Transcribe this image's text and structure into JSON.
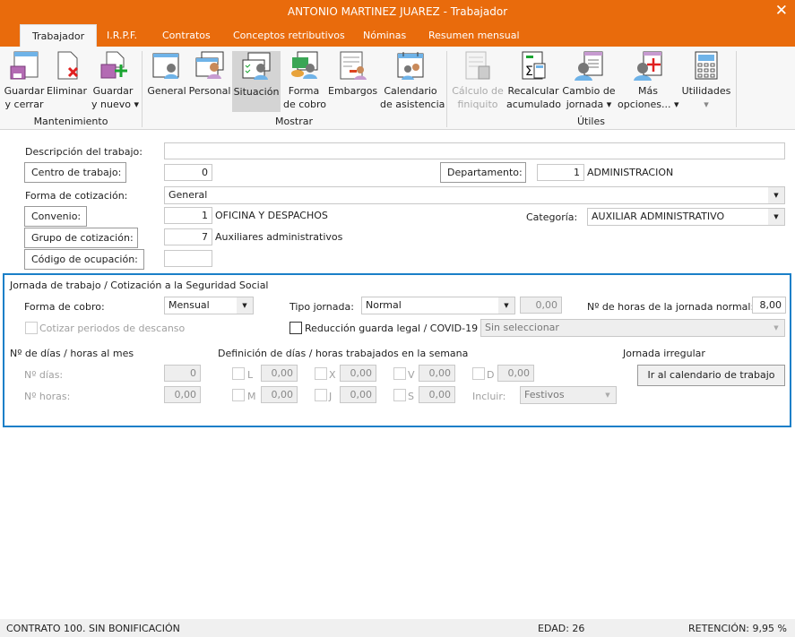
{
  "window": {
    "title": "ANTONIO MARTINEZ JUAREZ - Trabajador",
    "close_icon": "close-icon"
  },
  "tabs": [
    {
      "label": "Trabajador",
      "active": true
    },
    {
      "label": "I.R.P.F."
    },
    {
      "label": "Contratos"
    },
    {
      "label": "Conceptos retributivos"
    },
    {
      "label": "Nóminas"
    },
    {
      "label": "Resumen mensual"
    }
  ],
  "ribbon": {
    "groups": {
      "mantenimiento": "Mantenimiento",
      "mostrar": "Mostrar",
      "utiles": "Útiles"
    },
    "buttons": {
      "guardar_cerrar": [
        "Guardar",
        "y cerrar"
      ],
      "eliminar": [
        "Eliminar",
        ""
      ],
      "guardar_nuevo": [
        "Guardar",
        "y nuevo ▾"
      ],
      "general": [
        "General",
        ""
      ],
      "personal": [
        "Personal",
        ""
      ],
      "situacion": [
        "Situación",
        ""
      ],
      "forma_cobro": [
        "Forma",
        "de cobro"
      ],
      "embargos": [
        "Embargos",
        ""
      ],
      "calendario": [
        "Calendario",
        "de asistencia"
      ],
      "finiquito": [
        "Cálculo de",
        "finiquito"
      ],
      "recalcular": [
        "Recalcular",
        "acumulado"
      ],
      "cambio_jornada": [
        "Cambio de",
        "jornada ▾"
      ],
      "mas_opciones": [
        "Más",
        "opciones... ▾"
      ],
      "utilidades": [
        "Utilidades",
        "▾"
      ]
    },
    "selected": "Situación"
  },
  "form": {
    "descripcion_label": "Descripción del trabajo:",
    "descripcion_value": "",
    "centro_btn": "Centro de trabajo:",
    "centro_value": "0",
    "departamento_btn": "Departamento:",
    "departamento_value": "1",
    "departamento_name": "ADMINISTRACION",
    "forma_cotizacion_label": "Forma de cotización:",
    "forma_cotizacion_value": "General",
    "convenio_btn": "Convenio:",
    "convenio_value": "1",
    "convenio_name": "OFICINA Y DESPACHOS",
    "categoria_label": "Categoría:",
    "categoria_value": "AUXILIAR ADMINISTRATIVO",
    "grupo_btn": "Grupo de cotización:",
    "grupo_value": "7",
    "grupo_name": "Auxiliares administrativos",
    "codigo_btn": "Código de ocupación:",
    "codigo_value": ""
  },
  "jornada": {
    "title": "Jornada de trabajo / Cotización a la Seguridad Social",
    "forma_cobro_label": "Forma de cobro:",
    "forma_cobro_value": "Mensual",
    "tipo_jornada_label": "Tipo jornada:",
    "tipo_jornada_value": "Normal",
    "tipo_jornada_pct": "0,00",
    "horas_normal_label": "Nº de horas de la jornada normal:",
    "horas_normal_value": "8,00",
    "cotizar_label": "Cotizar periodos de descanso",
    "reduccion_label": "Reducción guarda legal / COVID-19",
    "reduccion_value": "Sin seleccionar",
    "dias_horas_title": "Nº de días / horas al mes",
    "n_dias_label": "Nº días:",
    "n_dias_value": "0",
    "n_horas_label": "Nº horas:",
    "n_horas_value": "0,00",
    "definicion_title": "Definición de días / horas trabajados en la semana",
    "days": [
      {
        "d": "L",
        "v": "0,00"
      },
      {
        "d": "X",
        "v": "0,00"
      },
      {
        "d": "V",
        "v": "0,00"
      },
      {
        "d": "D",
        "v": "0,00"
      },
      {
        "d": "M",
        "v": "0,00"
      },
      {
        "d": "J",
        "v": "0,00"
      },
      {
        "d": "S",
        "v": "0,00"
      }
    ],
    "incluir_label": "Incluir:",
    "incluir_value": "Festivos",
    "irregular_title": "Jornada irregular",
    "calendario_btn": "Ir al calendario de trabajo"
  },
  "status": {
    "contrato": "CONTRATO 100.  SIN BONIFICACIÓN",
    "edad": "EDAD: 26",
    "retencion": "RETENCIÓN: 9,95 %"
  },
  "colors": {
    "accent": "#E96B0C",
    "frame": "#1a7fc8"
  }
}
